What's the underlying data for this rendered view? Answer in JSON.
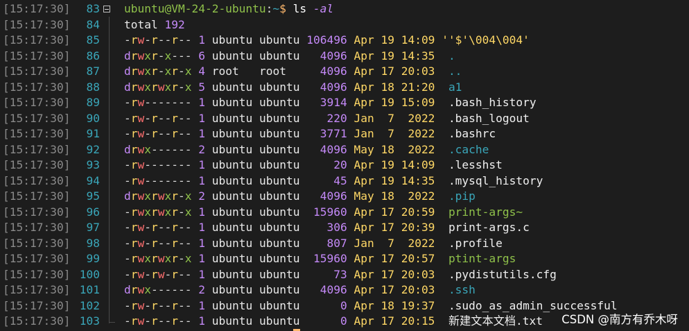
{
  "prompt": {
    "user_host": "ubuntu@VM-24-2-ubuntu",
    "colon": ":",
    "path": "~",
    "dollar": "$",
    "command": "ls",
    "flag": "-al"
  },
  "timestamp": "[15:17:30]",
  "prompt_line_number": "83",
  "total_line": {
    "label": "total",
    "value": "192",
    "line_number": "84"
  },
  "entries": [
    {
      "ln": "85",
      "perm": "-rw-r--r--",
      "links": "1",
      "user": "ubuntu",
      "group": "ubuntu",
      "size": "106496",
      "month": "Apr",
      "day": "19",
      "time": "14:09",
      "name": "''$'\\004\\004'",
      "kind": "quote"
    },
    {
      "ln": "86",
      "perm": "drwxr-x---",
      "links": "6",
      "user": "ubuntu",
      "group": "ubuntu",
      "size": "4096",
      "month": "Apr",
      "day": "19",
      "time": "14:35",
      "name": ".",
      "kind": "dir"
    },
    {
      "ln": "87",
      "perm": "drwxr-xr-x",
      "links": "4",
      "user": "root",
      "group": "root",
      "size": "4096",
      "month": "Apr",
      "day": "17",
      "time": "20:03",
      "name": "..",
      "kind": "dir"
    },
    {
      "ln": "88",
      "perm": "drwxrwxr-x",
      "links": "5",
      "user": "ubuntu",
      "group": "ubuntu",
      "size": "4096",
      "month": "Apr",
      "day": "18",
      "time": "21:20",
      "name": "a1",
      "kind": "dir"
    },
    {
      "ln": "89",
      "perm": "-rw-------",
      "links": "1",
      "user": "ubuntu",
      "group": "ubuntu",
      "size": "3914",
      "month": "Apr",
      "day": "19",
      "time": "15:09",
      "name": ".bash_history",
      "kind": "file"
    },
    {
      "ln": "90",
      "perm": "-rw-r--r--",
      "links": "1",
      "user": "ubuntu",
      "group": "ubuntu",
      "size": "220",
      "month": "Jan",
      "day": "7",
      "time": "2022",
      "name": ".bash_logout",
      "kind": "file"
    },
    {
      "ln": "91",
      "perm": "-rw-r--r--",
      "links": "1",
      "user": "ubuntu",
      "group": "ubuntu",
      "size": "3771",
      "month": "Jan",
      "day": "7",
      "time": "2022",
      "name": ".bashrc",
      "kind": "file"
    },
    {
      "ln": "92",
      "perm": "drwx------",
      "links": "2",
      "user": "ubuntu",
      "group": "ubuntu",
      "size": "4096",
      "month": "May",
      "day": "18",
      "time": "2022",
      "name": ".cache",
      "kind": "dir"
    },
    {
      "ln": "93",
      "perm": "-rw-------",
      "links": "1",
      "user": "ubuntu",
      "group": "ubuntu",
      "size": "20",
      "month": "Apr",
      "day": "19",
      "time": "14:09",
      "name": ".lesshst",
      "kind": "file"
    },
    {
      "ln": "94",
      "perm": "-rw-------",
      "links": "1",
      "user": "ubuntu",
      "group": "ubuntu",
      "size": "45",
      "month": "Apr",
      "day": "19",
      "time": "14:35",
      "name": ".mysql_history",
      "kind": "file"
    },
    {
      "ln": "95",
      "perm": "drwxrwxr-x",
      "links": "2",
      "user": "ubuntu",
      "group": "ubuntu",
      "size": "4096",
      "month": "May",
      "day": "18",
      "time": "2022",
      "name": ".pip",
      "kind": "dir"
    },
    {
      "ln": "96",
      "perm": "-rwxrwxr-x",
      "links": "1",
      "user": "ubuntu",
      "group": "ubuntu",
      "size": "15960",
      "month": "Apr",
      "day": "17",
      "time": "20:59",
      "name": "print-args~",
      "kind": "exec"
    },
    {
      "ln": "97",
      "perm": "-rw-r--r--",
      "links": "1",
      "user": "ubuntu",
      "group": "ubuntu",
      "size": "306",
      "month": "Apr",
      "day": "17",
      "time": "20:39",
      "name": "print-args.c",
      "kind": "file"
    },
    {
      "ln": "98",
      "perm": "-rw-r--r--",
      "links": "1",
      "user": "ubuntu",
      "group": "ubuntu",
      "size": "807",
      "month": "Jan",
      "day": "7",
      "time": "2022",
      "name": ".profile",
      "kind": "file"
    },
    {
      "ln": "99",
      "perm": "-rwxrwxr-x",
      "links": "1",
      "user": "ubuntu",
      "group": "ubuntu",
      "size": "15960",
      "month": "Apr",
      "day": "17",
      "time": "20:57",
      "name": "ptint-args",
      "kind": "exec"
    },
    {
      "ln": "100",
      "perm": "-rw-rw-r--",
      "links": "1",
      "user": "ubuntu",
      "group": "ubuntu",
      "size": "73",
      "month": "Apr",
      "day": "17",
      "time": "20:03",
      "name": ".pydistutils.cfg",
      "kind": "file"
    },
    {
      "ln": "101",
      "perm": "drwx------",
      "links": "2",
      "user": "ubuntu",
      "group": "ubuntu",
      "size": "4096",
      "month": "Apr",
      "day": "17",
      "time": "20:03",
      "name": ".ssh",
      "kind": "dir"
    },
    {
      "ln": "102",
      "perm": "-rw-r--r--",
      "links": "1",
      "user": "ubuntu",
      "group": "ubuntu",
      "size": "0",
      "month": "Apr",
      "day": "18",
      "time": "19:37",
      "name": ".sudo_as_admin_successful",
      "kind": "file"
    },
    {
      "ln": "103",
      "perm": "-rw-r--r--",
      "links": "1",
      "user": "ubuntu",
      "group": "ubuntu",
      "size": "0",
      "month": "Apr",
      "day": "17",
      "time": "20:15",
      "name": "新建文本文档.txt",
      "kind": "file"
    }
  ],
  "watermark": "CSDN @南方有乔木呀"
}
